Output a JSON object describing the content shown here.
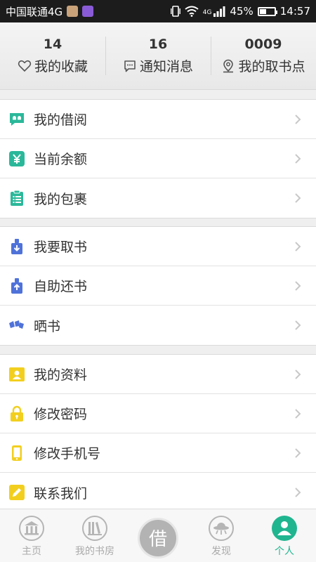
{
  "status": {
    "carrier": "中国联通4G",
    "network": "4G",
    "battery": "45%",
    "battery_level": 0.45,
    "time": "14:57"
  },
  "stats": [
    {
      "value": "14",
      "label": "我的收藏",
      "icon": "heart-icon"
    },
    {
      "value": "16",
      "label": "通知消息",
      "icon": "message-icon"
    },
    {
      "value": "0009",
      "label": "我的取书点",
      "icon": "location-icon"
    }
  ],
  "groups": [
    [
      {
        "label": "我的借阅",
        "icon": "borrow-chat-icon",
        "color": "#2bb89a"
      },
      {
        "label": "当前余额",
        "icon": "yen-icon",
        "color": "#2bb89a"
      },
      {
        "label": "我的包裹",
        "icon": "clipboard-icon",
        "color": "#2bb89a"
      }
    ],
    [
      {
        "label": "我要取书",
        "icon": "pickup-icon",
        "color": "#4f72d9"
      },
      {
        "label": "自助还书",
        "icon": "return-icon",
        "color": "#4f72d9"
      },
      {
        "label": "晒书",
        "icon": "share-books-icon",
        "color": "#4f72d9"
      }
    ],
    [
      {
        "label": "我的资料",
        "icon": "profile-icon",
        "color": "#f2cf1f"
      },
      {
        "label": "修改密码",
        "icon": "lock-icon",
        "color": "#f2cf1f"
      },
      {
        "label": "修改手机号",
        "icon": "phone-icon",
        "color": "#f2cf1f"
      },
      {
        "label": "联系我们",
        "icon": "pencil-icon",
        "color": "#f2cf1f"
      }
    ]
  ],
  "nav": {
    "home": "主页",
    "bookroom": "我的书房",
    "borrow": "借",
    "discover": "发现",
    "me": "个人"
  },
  "colors": {
    "accent": "#1fb58f",
    "inactive": "#aaaaaa"
  }
}
